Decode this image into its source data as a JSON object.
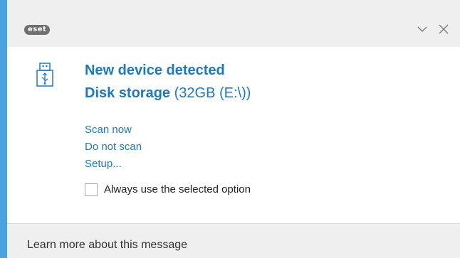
{
  "app": {
    "logo_text": "eset",
    "accent_color": "#4aa3df",
    "link_color": "#1a78c8"
  },
  "titlebar": {
    "minimize_icon": "chevron-down-icon",
    "close_icon": "close-icon"
  },
  "notification": {
    "device_icon": "usb-drive-icon",
    "headline": "New device detected",
    "device_name": "Disk storage",
    "device_detail": " (32GB (E:\\))"
  },
  "actions": {
    "scan_now": "Scan now",
    "do_not_scan": "Do not scan",
    "setup": "Setup..."
  },
  "remember": {
    "label": "Always use the selected option",
    "checked": false
  },
  "footer": {
    "learn_more": "Learn more about this message"
  }
}
